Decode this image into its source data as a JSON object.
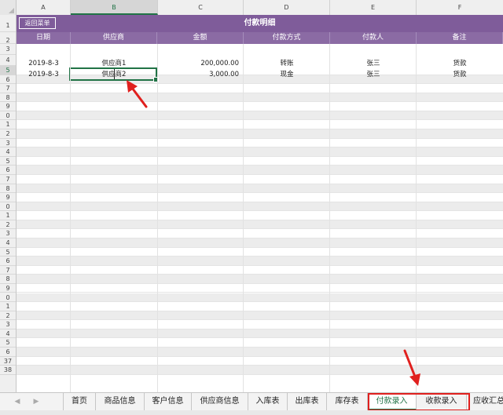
{
  "columns": [
    "A",
    "B",
    "C",
    "D",
    "E",
    "F"
  ],
  "selected_column": "B",
  "rows": [
    "1",
    "2",
    "3",
    "4",
    "5",
    "6",
    "7",
    "8",
    "9",
    "0",
    "1",
    "2",
    "3",
    "4",
    "5",
    "6",
    "7",
    "8",
    "9",
    "0",
    "1",
    "2",
    "3",
    "4",
    "5",
    "6",
    "7",
    "8",
    "9",
    "0",
    "1",
    "2",
    "3",
    "4",
    "5",
    "6",
    "37",
    "38"
  ],
  "selected_row_index": 4,
  "sheet": {
    "back_button": "返回菜单",
    "title": "付款明细",
    "headers": [
      "日期",
      "供应商",
      "金额",
      "付款方式",
      "付款人",
      "备注"
    ],
    "data_rows": [
      {
        "date": "2019-8-3",
        "supplier": "供应商1",
        "amount": "200,000.00",
        "method": "转账",
        "payer": "张三",
        "note": "货款"
      },
      {
        "date": "2019-8-3",
        "supplier": "供应商2",
        "amount": "3,000.00",
        "method": "现金",
        "payer": "张三",
        "note": "货款"
      }
    ]
  },
  "tabs": [
    "首页",
    "商品信息",
    "客户信息",
    "供应商信息",
    "入库表",
    "出库表",
    "库存表",
    "付款录入",
    "收款录入",
    "应收汇总"
  ],
  "active_tab": "付款录入",
  "colors": {
    "title_bg": "#7f5c9a",
    "header_bg": "#8b6ba4",
    "stripe": "#ececec",
    "accent": "#217346",
    "annotation": "#e0201e"
  },
  "icons": [
    "tab-nav-prev-icon",
    "tab-nav-next-icon",
    "corner-select-all-icon",
    "annotation-arrow-icon"
  ]
}
